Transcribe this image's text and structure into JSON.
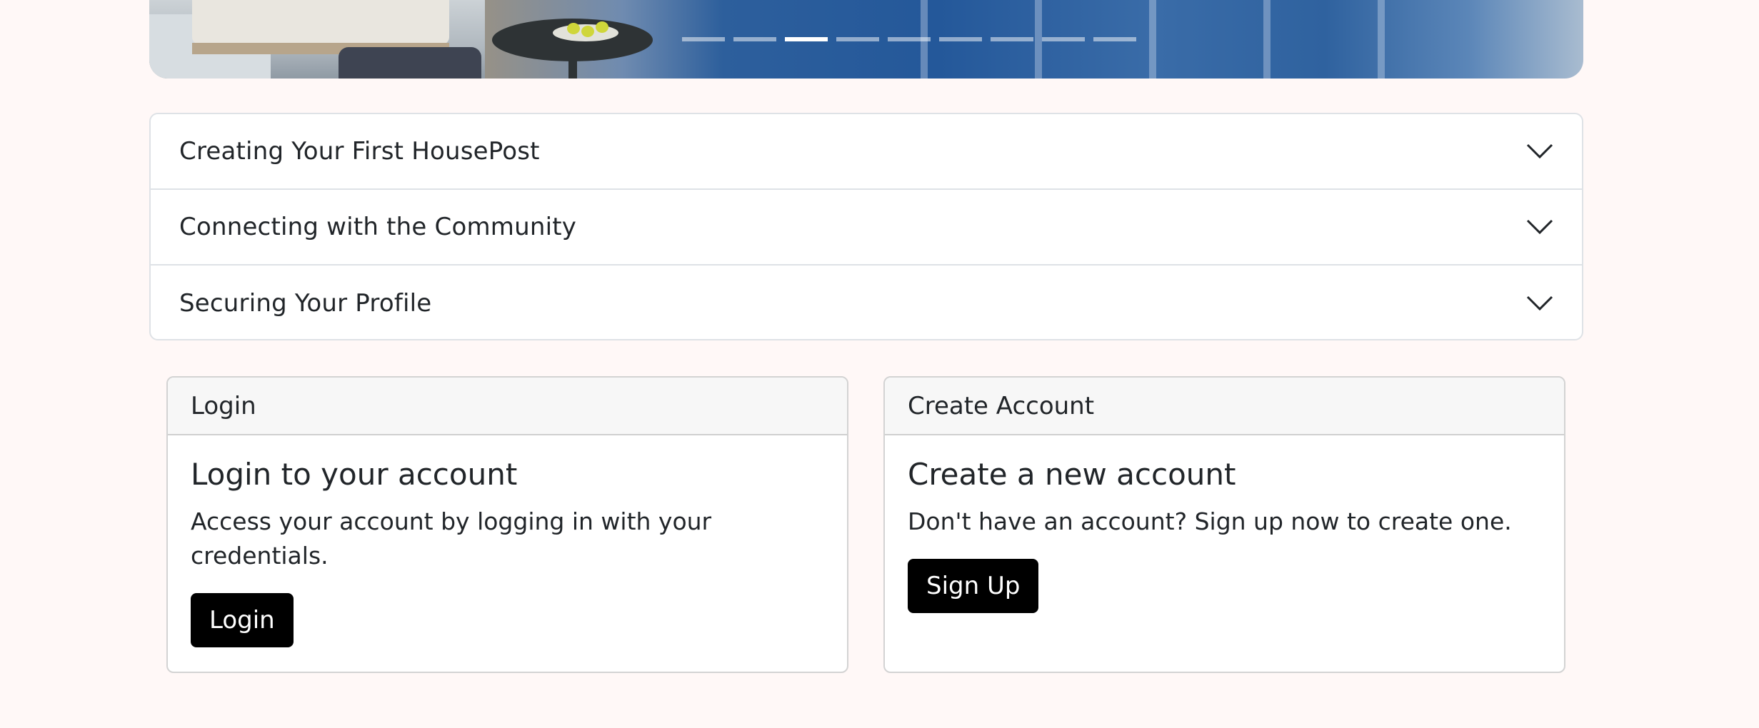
{
  "carousel": {
    "slide_count": 9,
    "active_slide": 3
  },
  "accordion": {
    "items": [
      {
        "title": "Creating Your First HousePost",
        "icon": "chevron-down-icon"
      },
      {
        "title": "Connecting with the Community",
        "icon": "chevron-down-icon"
      },
      {
        "title": "Securing Your Profile",
        "icon": "chevron-down-icon"
      }
    ]
  },
  "login_card": {
    "header": "Login",
    "title": "Login to your account",
    "text": "Access your account by logging in with your credentials.",
    "button_label": "Login"
  },
  "create_card": {
    "header": "Create Account",
    "title": "Create a new account",
    "text": "Don't have an account? Sign up now to create one.",
    "button_label": "Sign Up"
  },
  "colors": {
    "page_background": "#fff8f7",
    "button_background": "#000000",
    "button_text": "#ffffff"
  }
}
